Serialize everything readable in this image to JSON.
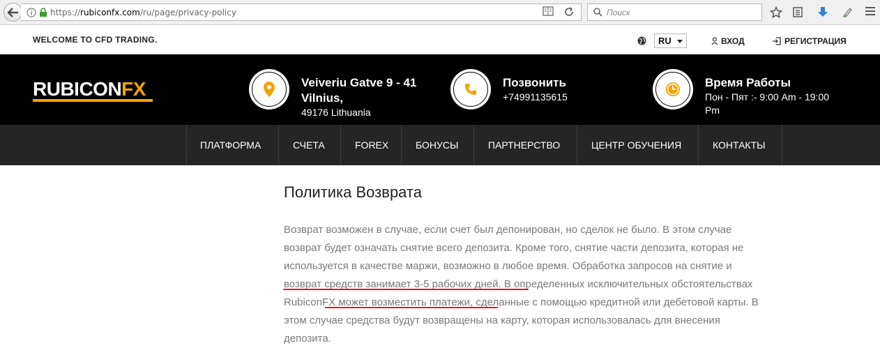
{
  "browser": {
    "url_prefix": "https://",
    "url_host": "rubiconfx.com",
    "url_path": "/ru/page/privacy-policy",
    "search_placeholder": "Поиск"
  },
  "topbar": {
    "welcome": "WELCOME TO CFD TRADING.",
    "language": "RU",
    "login": "ВХОД",
    "register": "РЕГИСТРАЦИЯ"
  },
  "header": {
    "logo_part1": "RUBICON",
    "logo_part2": "FX",
    "address": {
      "line1": "Veiveriu Gatve 9 - 41",
      "line2": "Vilnius,",
      "line3": "49176 Lithuania",
      "icon": "location-pin-icon"
    },
    "phone": {
      "title": "Позвонить",
      "number": "+74991135615",
      "icon": "phone-icon"
    },
    "hours": {
      "title": "Время Работы",
      "line1": "Пон - Пят :- 9:00 Am - 19:00",
      "line2": "Pm",
      "icon": "clock-icon"
    },
    "accent_color": "#f5a300"
  },
  "nav": {
    "items": [
      "ПЛАТФОРМА",
      "СЧЕТА",
      "FOREX",
      "БОНУСЫ",
      "ПАРТНЕРСТВО",
      "ЦЕНТР ОБУЧЕНИЯ",
      "КОНТАКТЫ"
    ]
  },
  "content": {
    "title": "Политика Возврата",
    "lines": [
      "Возврат возможен в случае, если счет был депонирован, но сделок не было. В этом случае",
      "возврат будет означать снятие всего депозита. Кроме того, снятие части депозита, которая не",
      "используется в качестве маржи, возможно в любое время. Обработка запросов на снятие и",
      "возврат средств занимает 3-5 рабочих дней. В определенных исключительных обстоятельствах",
      "RubiconFX может возместить платежи, сделанные с помощью кредитной или дебетовой карты. В",
      "этом случае средства будут возвращены на карту, которая использовалась для внесения",
      "депозита."
    ],
    "underline_color": "#e51b1b"
  }
}
